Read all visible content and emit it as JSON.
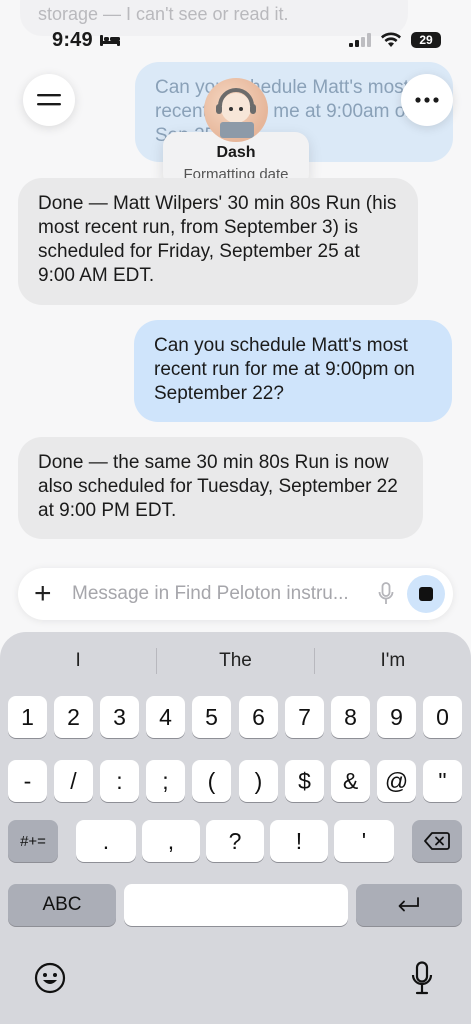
{
  "background_chat": {
    "faded_text": "storage — I can't see or read it.",
    "faded_user_message": "Can you schedule Matt's most recent run for me at 9:00am on Sep 25?"
  },
  "status_bar": {
    "time": "9:49",
    "battery": "29"
  },
  "agent": {
    "name": "Dash",
    "status": "Formatting date"
  },
  "messages": [
    {
      "role": "bot",
      "text": "Done — Matt Wilpers' 30 min 80s Run (his most recent run, from September 3) is scheduled for Friday, September 25 at 9:00 AM EDT."
    },
    {
      "role": "user",
      "text": "Can you schedule Matt's most recent run for me at 9:00pm on September 22?"
    },
    {
      "role": "bot",
      "text": "Done — the same 30 min 80s Run is now also scheduled for Tuesday, September 22 at 9:00 PM EDT."
    }
  ],
  "composer": {
    "plus": "+",
    "placeholder": "Message in Find Peloton instru..."
  },
  "keyboard": {
    "suggestions": [
      "I",
      "The",
      "I'm"
    ],
    "row1": [
      "1",
      "2",
      "3",
      "4",
      "5",
      "6",
      "7",
      "8",
      "9",
      "0"
    ],
    "row2": [
      "-",
      "/",
      ":",
      ";",
      "(",
      ")",
      "$",
      "&",
      "@",
      "\""
    ],
    "row3_left": "#+=",
    "row3": [
      ".",
      ",",
      "?",
      "!",
      "'"
    ],
    "abc": "ABC"
  },
  "colors": {
    "user_bubble": "#cfe4fb",
    "bot_bubble": "#e9e9ea",
    "keyboard": "#d6d7dc"
  }
}
